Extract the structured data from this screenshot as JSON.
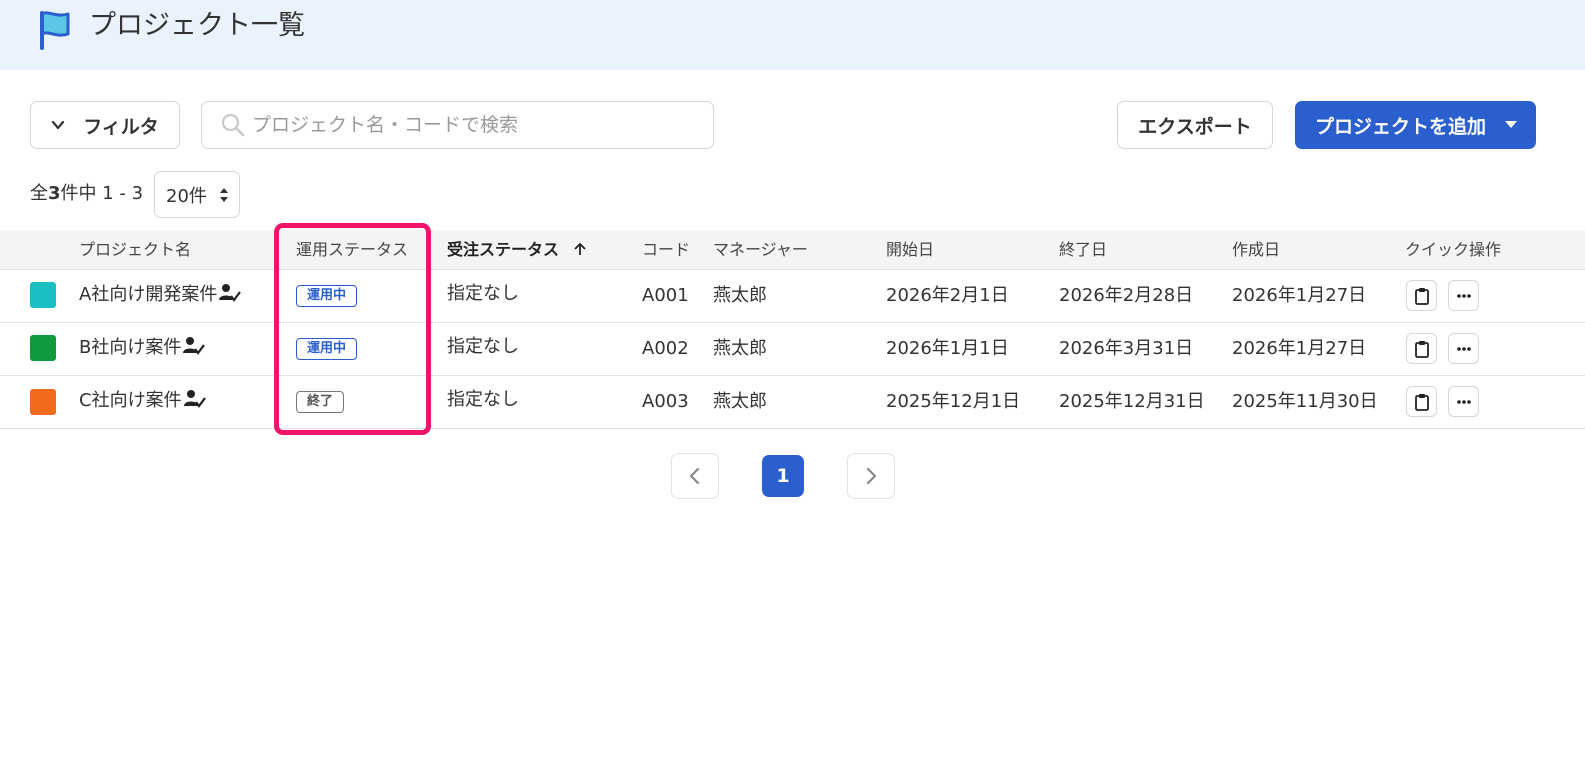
{
  "header": {
    "title": "プロジェクト一覧",
    "icon": "flag-icon",
    "icon_color": "#2b5fce",
    "icon_fill": "#5cc6e6",
    "bg": "#eaf2fd"
  },
  "toolbar": {
    "filter_label": "フィルタ",
    "search_placeholder": "プロジェクト名・コードで検索",
    "search_value": "",
    "export_label": "エクスポート",
    "add_label": "プロジェクトを追加",
    "accent": "#2b5fce"
  },
  "summary": {
    "prefix": "全",
    "total": "3",
    "suffix": "件中 1 - 3"
  },
  "per_page": {
    "selected": "20件"
  },
  "table": {
    "columns": {
      "name": "プロジェクト名",
      "op_status": "運用ステータス",
      "order_status": "受注ステータス",
      "code": "コード",
      "manager": "マネージャー",
      "start": "開始日",
      "end": "終了日",
      "created": "作成日",
      "quick": "クイック操作"
    },
    "rows": [
      {
        "color": "#1bbfc2",
        "name": "A社向け開発案件",
        "op_status": "運用中",
        "op_kind": "active",
        "order_status": "指定なし",
        "code": "A001",
        "manager": "燕太郎",
        "start": "2026年2月1日",
        "end": "2026年2月28日",
        "created": "2026年1月27日"
      },
      {
        "color": "#0f9a3d",
        "name": "B社向け案件",
        "op_status": "運用中",
        "op_kind": "active",
        "order_status": "指定なし",
        "code": "A002",
        "manager": "燕太郎",
        "start": "2026年1月1日",
        "end": "2026年3月31日",
        "created": "2026年1月27日"
      },
      {
        "color": "#f26a1b",
        "name": "C社向け案件",
        "op_status": "終了",
        "op_kind": "ended",
        "order_status": "指定なし",
        "code": "A003",
        "manager": "燕太郎",
        "start": "2025年12月1日",
        "end": "2025年12月31日",
        "created": "2025年11月30日"
      }
    ]
  },
  "pagination": {
    "current": "1"
  },
  "highlight_color": "#f0146a"
}
